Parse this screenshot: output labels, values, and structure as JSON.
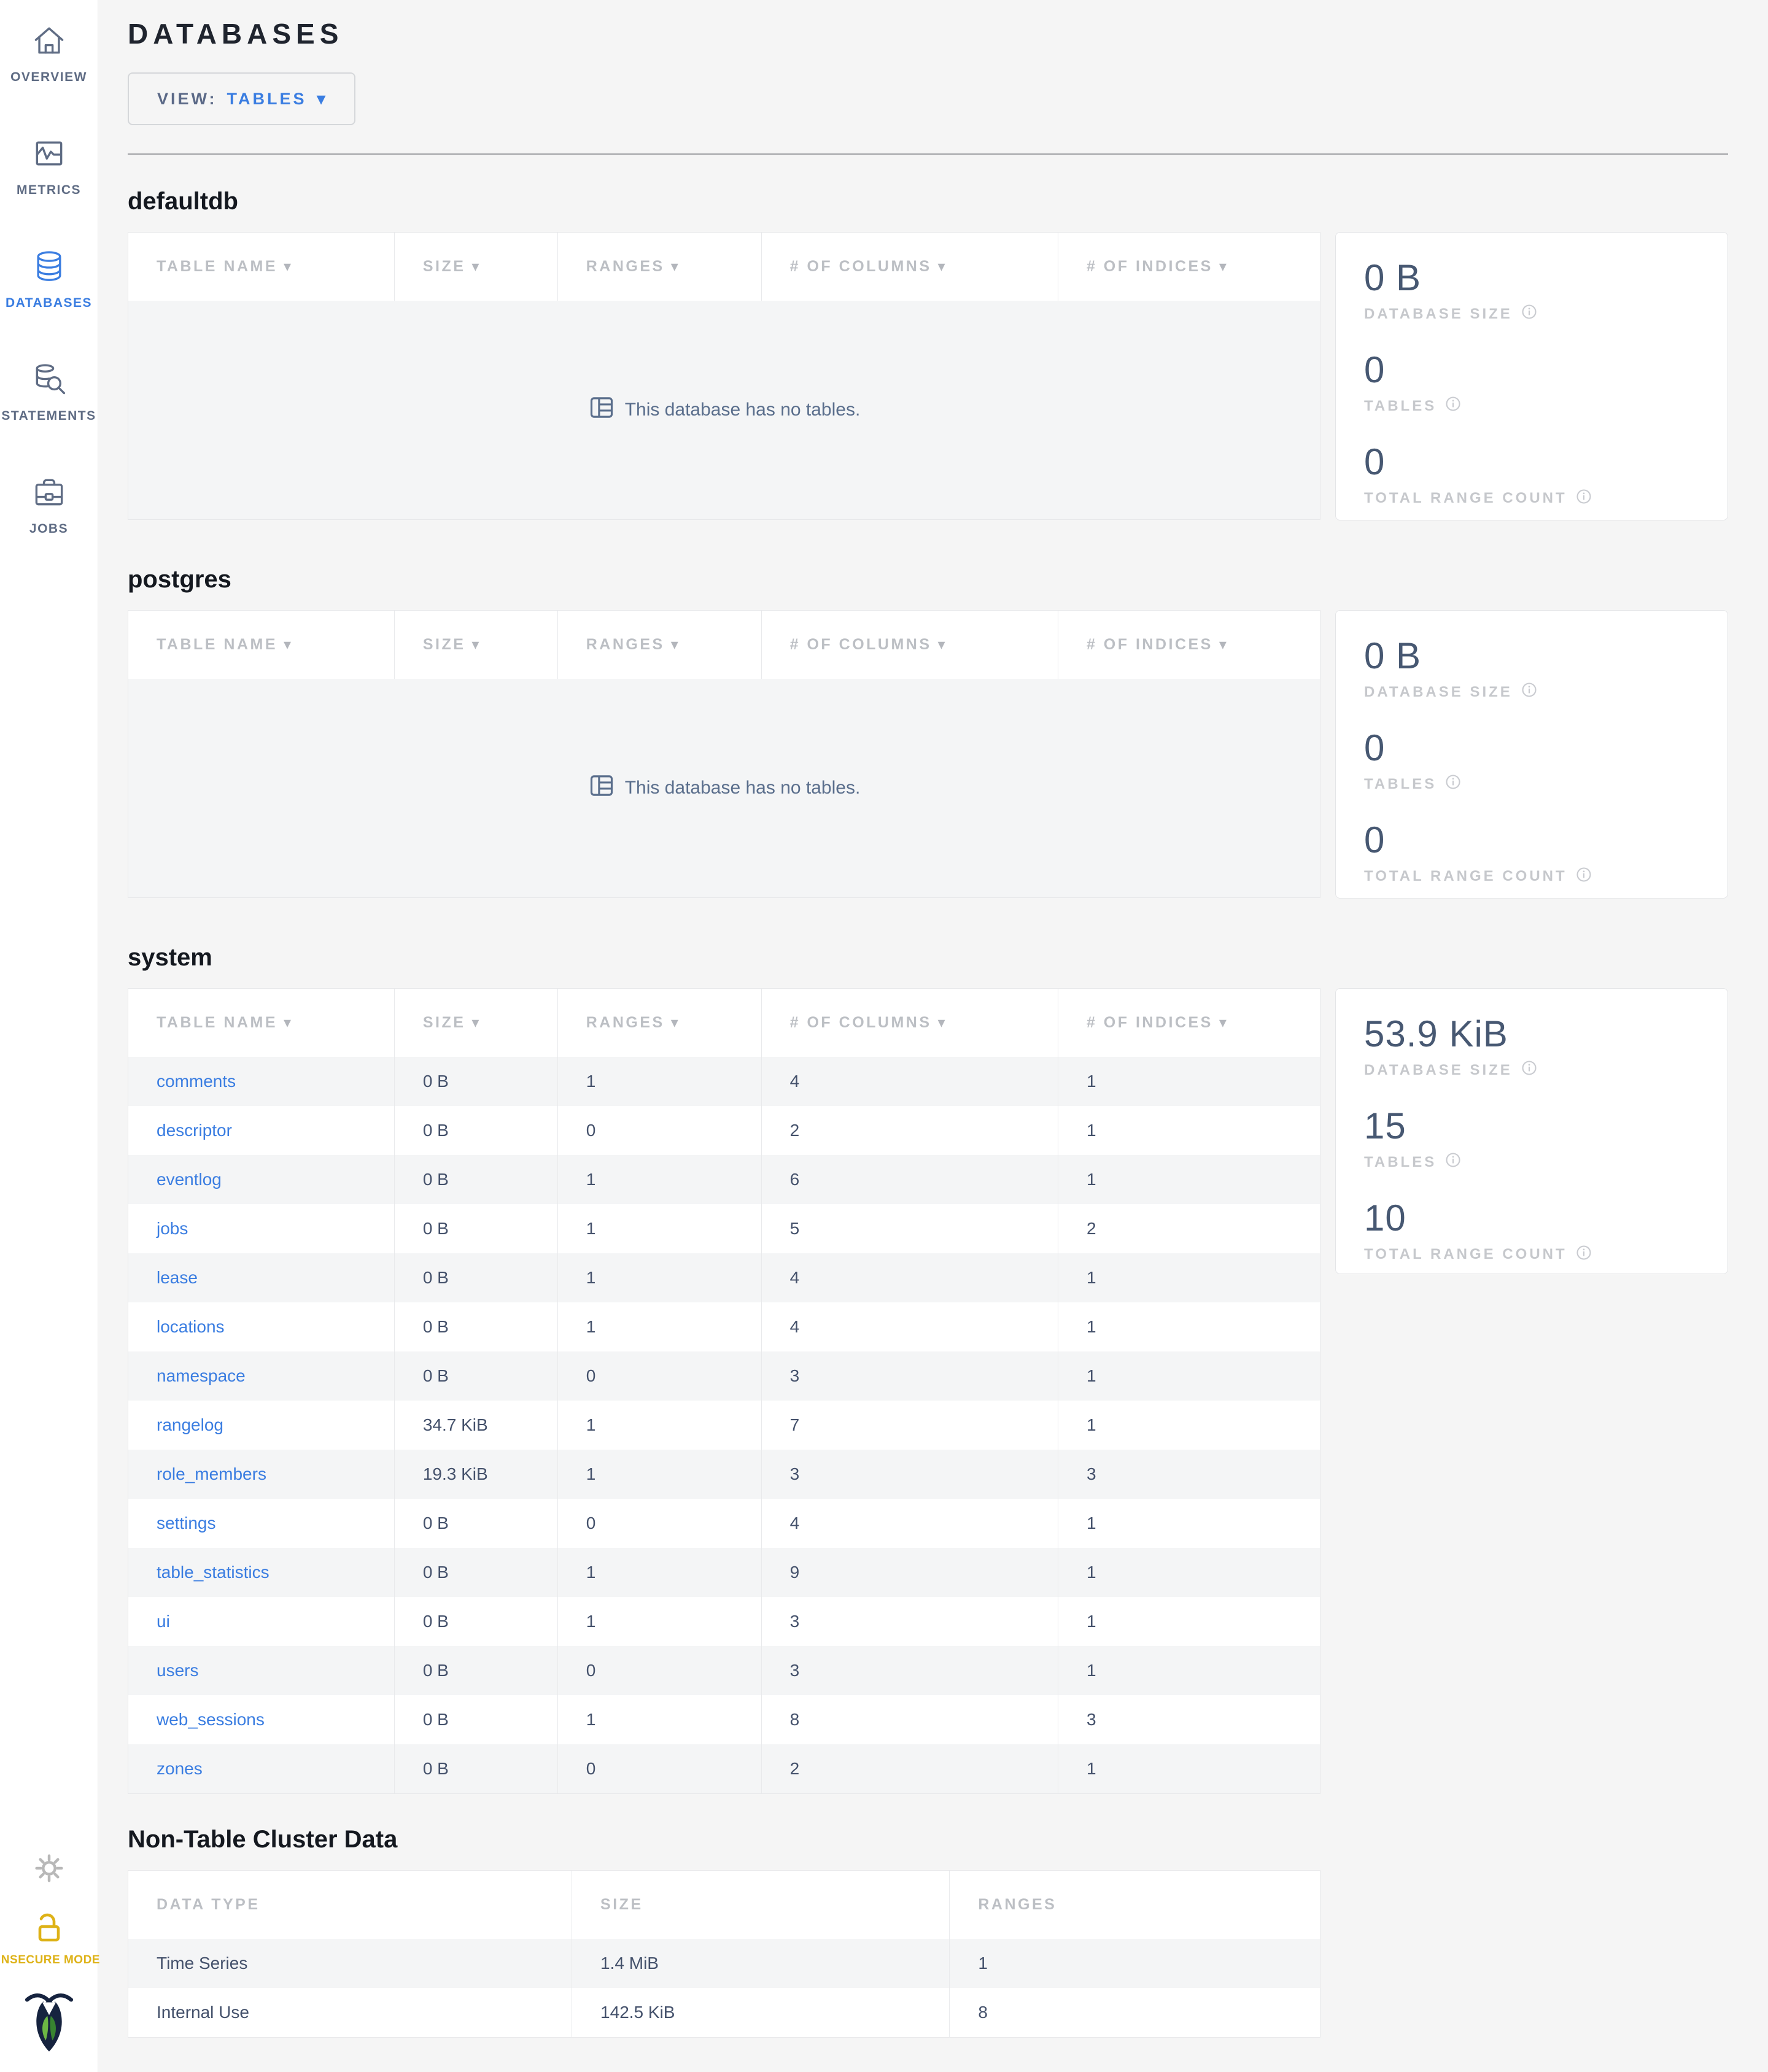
{
  "header": {
    "title": "DATABASES",
    "view_label": "VIEW:",
    "view_value": "TABLES"
  },
  "icons": {
    "sort_arrow": "▾",
    "view_caret": "▾"
  },
  "sidebar": {
    "items": [
      {
        "label": "OVERVIEW",
        "icon": "home-icon",
        "active": false
      },
      {
        "label": "METRICS",
        "icon": "metrics-icon",
        "active": false
      },
      {
        "label": "DATABASES",
        "icon": "databases-icon",
        "active": true
      },
      {
        "label": "STATEMENTS",
        "icon": "statements-icon",
        "active": false
      },
      {
        "label": "JOBS",
        "icon": "jobs-icon",
        "active": false
      }
    ],
    "insecure_mode_label": "INSECURE MODE"
  },
  "table_headers": [
    "TABLE NAME",
    "SIZE",
    "RANGES",
    "# OF COLUMNS",
    "# OF INDICES"
  ],
  "empty_message": "This database has no tables.",
  "stats_labels": {
    "size": "DATABASE SIZE",
    "tables": "TABLES",
    "ranges": "TOTAL RANGE COUNT"
  },
  "databases": [
    {
      "name": "defaultdb",
      "stats": {
        "size": "0 B",
        "tables": "0",
        "ranges": "0"
      }
    },
    {
      "name": "postgres",
      "stats": {
        "size": "0 B",
        "tables": "0",
        "ranges": "0"
      }
    },
    {
      "name": "system",
      "stats": {
        "size": "53.9 KiB",
        "tables": "15",
        "ranges": "10"
      },
      "rows": [
        [
          "comments",
          "0 B",
          "1",
          "4",
          "1"
        ],
        [
          "descriptor",
          "0 B",
          "0",
          "2",
          "1"
        ],
        [
          "eventlog",
          "0 B",
          "1",
          "6",
          "1"
        ],
        [
          "jobs",
          "0 B",
          "1",
          "5",
          "2"
        ],
        [
          "lease",
          "0 B",
          "1",
          "4",
          "1"
        ],
        [
          "locations",
          "0 B",
          "1",
          "4",
          "1"
        ],
        [
          "namespace",
          "0 B",
          "0",
          "3",
          "1"
        ],
        [
          "rangelog",
          "34.7 KiB",
          "1",
          "7",
          "1"
        ],
        [
          "role_members",
          "19.3 KiB",
          "1",
          "3",
          "3"
        ],
        [
          "settings",
          "0 B",
          "0",
          "4",
          "1"
        ],
        [
          "table_statistics",
          "0 B",
          "1",
          "9",
          "1"
        ],
        [
          "ui",
          "0 B",
          "1",
          "3",
          "1"
        ],
        [
          "users",
          "0 B",
          "0",
          "3",
          "1"
        ],
        [
          "web_sessions",
          "0 B",
          "1",
          "8",
          "3"
        ],
        [
          "zones",
          "0 B",
          "0",
          "2",
          "1"
        ]
      ]
    }
  ],
  "non_table": {
    "title": "Non-Table Cluster Data",
    "headers": [
      "DATA TYPE",
      "SIZE",
      "RANGES"
    ],
    "rows": [
      [
        "Time Series",
        "1.4 MiB",
        "1"
      ],
      [
        "Internal Use",
        "142.5 KiB",
        "8"
      ]
    ]
  },
  "colors": {
    "accent_blue": "#3a7de1",
    "slate": "#5a6e8c",
    "stat_number": "#475872",
    "insecure_yellow": "#deb217",
    "page_bg": "#f5f5f5",
    "logo_navy": "#16233f",
    "leaf_light": "#6cb744",
    "leaf_dark": "#388430"
  }
}
